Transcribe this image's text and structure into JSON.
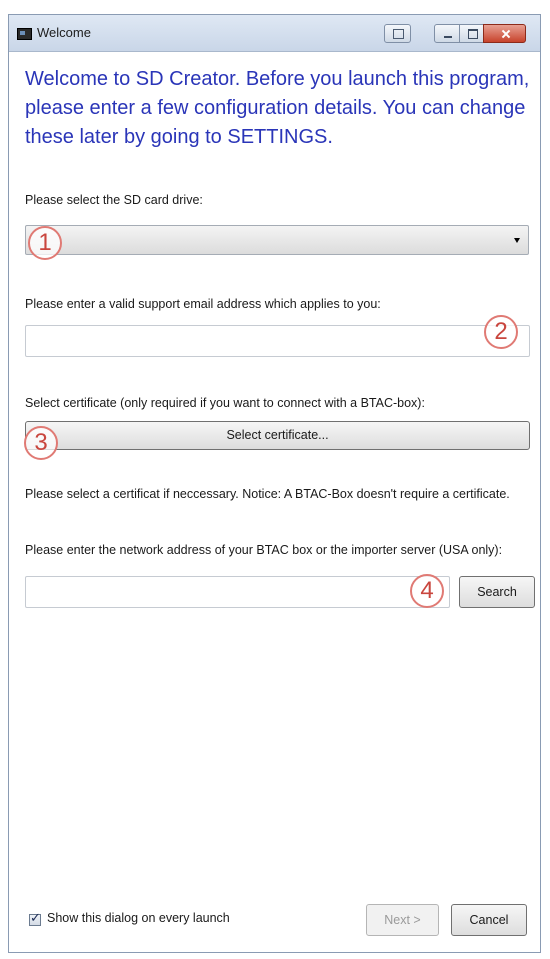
{
  "window": {
    "title": "Welcome",
    "welcome_text": "Welcome to SD Creator. Before you launch this program, please enter a few configuration details. You can change these later by going to SETTINGS."
  },
  "sd_card": {
    "label": "Please select the SD card drive:",
    "selected": ""
  },
  "email": {
    "label": "Please enter  a valid support email address which applies to you:",
    "value": ""
  },
  "certificate": {
    "label": "Select certificate (only required if you want to connect with a BTAC-box):",
    "button_label": "Select certificate...",
    "notice": "Please select a certificat if neccessary. Notice: A BTAC-Box doesn't require a certificate."
  },
  "network": {
    "label": "Please enter the network address of your BTAC box or the importer server (USA only):",
    "value": "",
    "search_label": "Search"
  },
  "footer": {
    "checkbox_label": "Show this dialog on every launch",
    "checkbox_checked": true,
    "next_label": "Next >",
    "cancel_label": "Cancel"
  },
  "markers": [
    "1",
    "2",
    "3",
    "4"
  ],
  "colors": {
    "welcome_text": "#2a35b8",
    "marker": "#c9463e",
    "close_button": "#c7432c"
  }
}
